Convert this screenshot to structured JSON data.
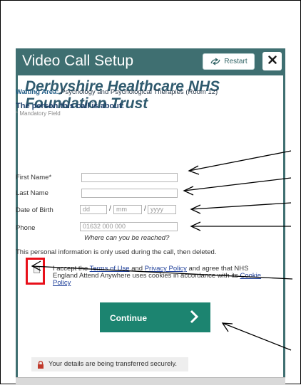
{
  "dialog": {
    "title": "Video Call Setup",
    "restart_label": "Restart",
    "close_icon": "close-icon",
    "restart_icon": "restart-arrows-icon"
  },
  "organization": "Derbyshire Healthcare NHS Foundation Trust",
  "waiting_area": {
    "label": "Waiting Area:",
    "value": "Psychology and Psychological Therapies (Room 12)"
  },
  "form": {
    "heading": "The person this call is about:",
    "mandatory_note": "* Mandatory Field",
    "first_name": {
      "label": "First Name*",
      "value": ""
    },
    "last_name": {
      "label": "Last Name",
      "value": ""
    },
    "dob": {
      "label": "Date of Birth",
      "dd_placeholder": "dd",
      "mm_placeholder": "mm",
      "yyyy_placeholder": "yyyy",
      "separator": "/"
    },
    "phone": {
      "label": "Phone",
      "placeholder": "01632 000 000",
      "hint": "Where can you be reached?"
    },
    "info_text": "This personal information is only used during the call, then deleted.",
    "consent": {
      "checked": false,
      "text_prefix": "I accept the ",
      "terms_link": "Terms of Use",
      "and": " and ",
      "privacy_link": "Privacy Policy",
      "text_suffix": " and agree that NHS England Attend Anywhere uses cookies in accordance with its ",
      "cookie_link": "Cookie Policy"
    }
  },
  "continue_label": "Continue",
  "secure_note": "Your details are being transferred securely.",
  "colors": {
    "header": "#3f6f71",
    "continue": "#1c8470",
    "highlight": "#e8101a",
    "org_name": "#2f5a6e"
  }
}
